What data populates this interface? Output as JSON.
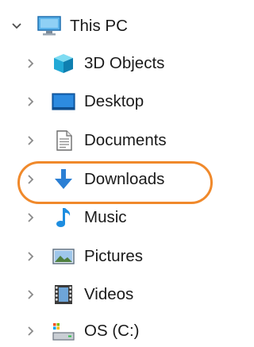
{
  "tree": {
    "root": {
      "label": "This PC",
      "expanded": true,
      "icon": "monitor-icon"
    },
    "items": [
      {
        "label": "3D Objects",
        "icon": "3d-objects-icon"
      },
      {
        "label": "Desktop",
        "icon": "desktop-folder-icon"
      },
      {
        "label": "Documents",
        "icon": "documents-icon"
      },
      {
        "label": "Downloads",
        "icon": "downloads-icon",
        "highlighted": true
      },
      {
        "label": "Music",
        "icon": "music-note-icon"
      },
      {
        "label": "Pictures",
        "icon": "pictures-icon"
      },
      {
        "label": "Videos",
        "icon": "videos-icon"
      },
      {
        "label": "OS (C:)",
        "icon": "drive-icon"
      }
    ]
  },
  "colors": {
    "highlight": "#f0892b",
    "chevron": "#6e6e6e",
    "monitor": "#1e8ad6",
    "download_arrow": "#2b7fd4"
  }
}
